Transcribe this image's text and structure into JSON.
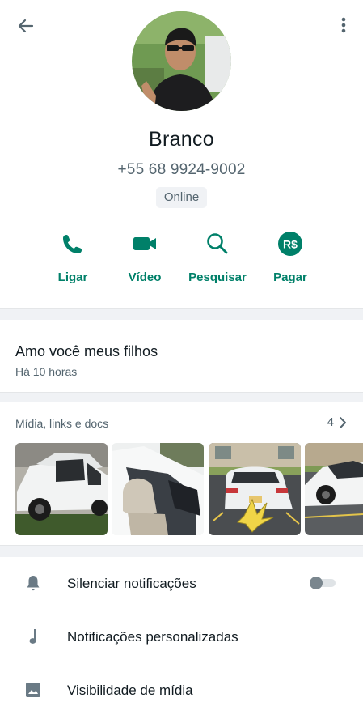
{
  "contact": {
    "name": "Branco",
    "phone": "+55 68 9924-9002",
    "status": "Online"
  },
  "actions": [
    {
      "label": "Ligar",
      "icon": "phone-icon"
    },
    {
      "label": "Vídeo",
      "icon": "video-icon"
    },
    {
      "label": "Pesquisar",
      "icon": "search-icon"
    },
    {
      "label": "Pagar",
      "icon": "pay-icon",
      "icon_text": "R$"
    }
  ],
  "about": {
    "text": "Amo você meus filhos",
    "time": "Há 10 horas"
  },
  "media": {
    "title": "Mídia, links e docs",
    "count": "4"
  },
  "settings": [
    {
      "label": "Silenciar notificações",
      "icon": "bell-icon",
      "has_toggle": true,
      "toggle_on": false
    },
    {
      "label": "Notificações personalizadas",
      "icon": "music-note-icon"
    },
    {
      "label": "Visibilidade de mídia",
      "icon": "image-icon"
    }
  ],
  "colors": {
    "accent": "#008069",
    "muted_text": "#54656f",
    "separator": "#f0f2f5"
  }
}
